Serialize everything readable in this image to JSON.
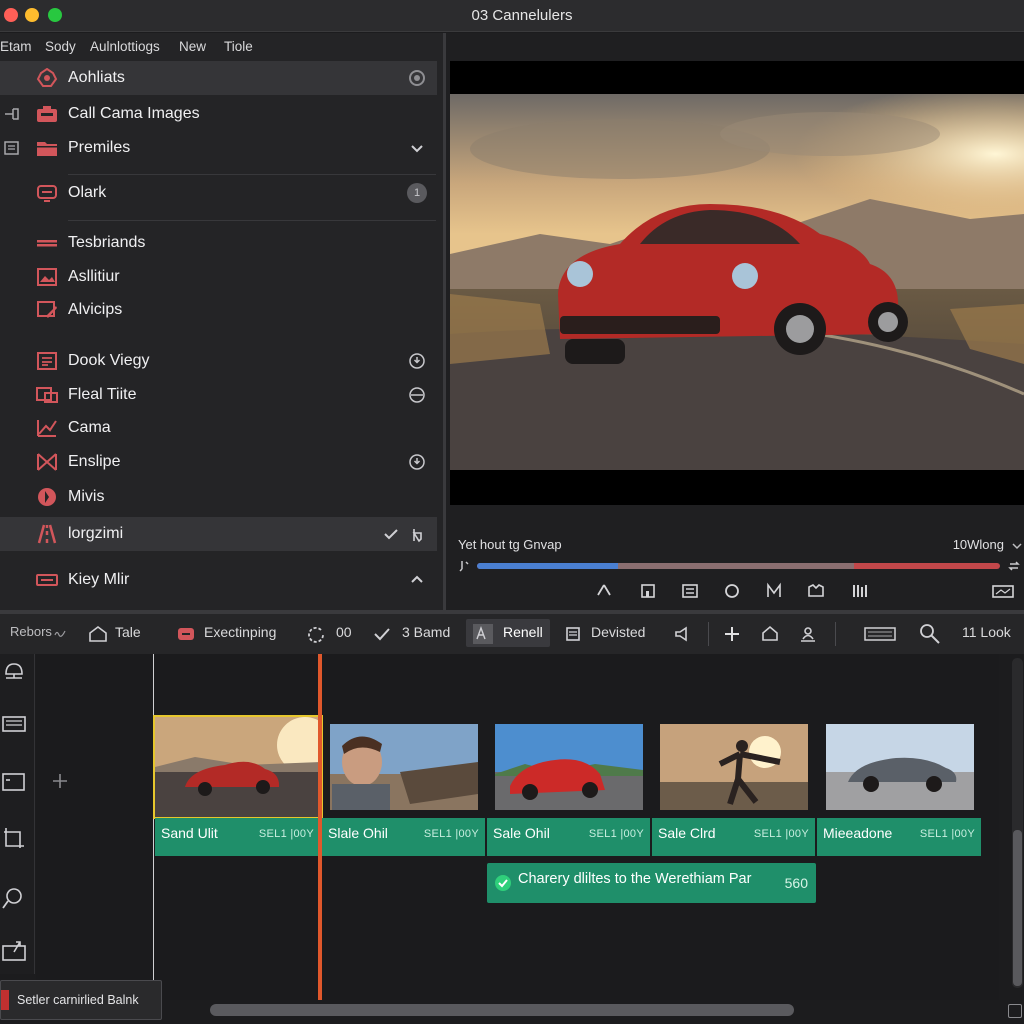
{
  "window": {
    "title": "03 Cannelulers"
  },
  "menu": [
    "Etam",
    "Sody",
    "Aulnlottiogs",
    "New",
    "Tiole"
  ],
  "sidebar": {
    "items": [
      {
        "label": "Aohliats",
        "icon": "palette-icon",
        "trail": "settings-icon"
      },
      {
        "label": "Call Cama Images",
        "icon": "camera-icon",
        "lead": "import-icon"
      },
      {
        "label": "Premiles",
        "icon": "folder-icon",
        "lead": "film-icon",
        "trail": "chevron-down-icon"
      },
      {
        "label": "Olark",
        "icon": "device-icon",
        "trail": "count-badge",
        "badge": "1"
      },
      {
        "label": "Tesbriands",
        "icon": "lines-icon"
      },
      {
        "label": "Asllitiur",
        "icon": "image-icon"
      },
      {
        "label": "Alvicips",
        "icon": "edit-icon"
      },
      {
        "label": "Dook Viegy",
        "icon": "doc-icon",
        "trail": "info-icon"
      },
      {
        "label": "Fleal Tiite",
        "icon": "media-icon",
        "trail": "minus-circle-icon"
      },
      {
        "label": "Cama",
        "icon": "chart-icon"
      },
      {
        "label": "Enslipe",
        "icon": "cross-icon",
        "trail": "info-icon"
      },
      {
        "label": "Mivis",
        "icon": "disc-icon"
      },
      {
        "label": "lorgzimi",
        "icon": "road-icon",
        "trail": "check-icon",
        "trail2": "touch-icon",
        "selected": true
      },
      {
        "label": "Kiey Mlir",
        "icon": "keyboard-icon",
        "trail": "chevron-up-icon"
      }
    ]
  },
  "viewer": {
    "caption": "Yet hout tg Gnvap",
    "right_text": "10Wlong",
    "scrub_progress": 0.27,
    "scrub_buffer": 0.72,
    "transport_icons": [
      "cursor-icon",
      "trim-icon",
      "list-icon",
      "loop-icon",
      "split-icon",
      "frame-icon",
      "bars-icon",
      "screen-icon"
    ]
  },
  "toolbar": {
    "reborn": "Rebors",
    "tale": "Tale",
    "exectinping": "Exectinping",
    "counter": "00",
    "bamd": "3 Bamd",
    "renell": "Renell",
    "devisted": "Devisted",
    "look": "11 Look"
  },
  "timeline": {
    "clips": [
      {
        "name": "Sand Ulit",
        "code": "SEL1 |00Y",
        "selected": true,
        "scene": "car-red"
      },
      {
        "name": "Slale Ohil",
        "code": "SEL1 |00Y",
        "scene": "man"
      },
      {
        "name": "Sale Ohil",
        "code": "SEL1 |00Y",
        "scene": "car-red-2"
      },
      {
        "name": "Sale Clrd",
        "code": "SEL1 |00Y",
        "scene": "person"
      },
      {
        "name": "Mieeadone",
        "code": "SEL1 |00Y",
        "scene": "car-grey"
      }
    ],
    "notification": {
      "text": "Charery dliltes to the Werethiam Par",
      "value": "560"
    }
  },
  "status": {
    "text": "Setler carnirlied Balnk"
  },
  "colors": {
    "accent_green": "#1f8f6a",
    "playhead": "#e0582c",
    "icon_red": "#d2565b",
    "selection_yellow": "#e6c72d"
  }
}
